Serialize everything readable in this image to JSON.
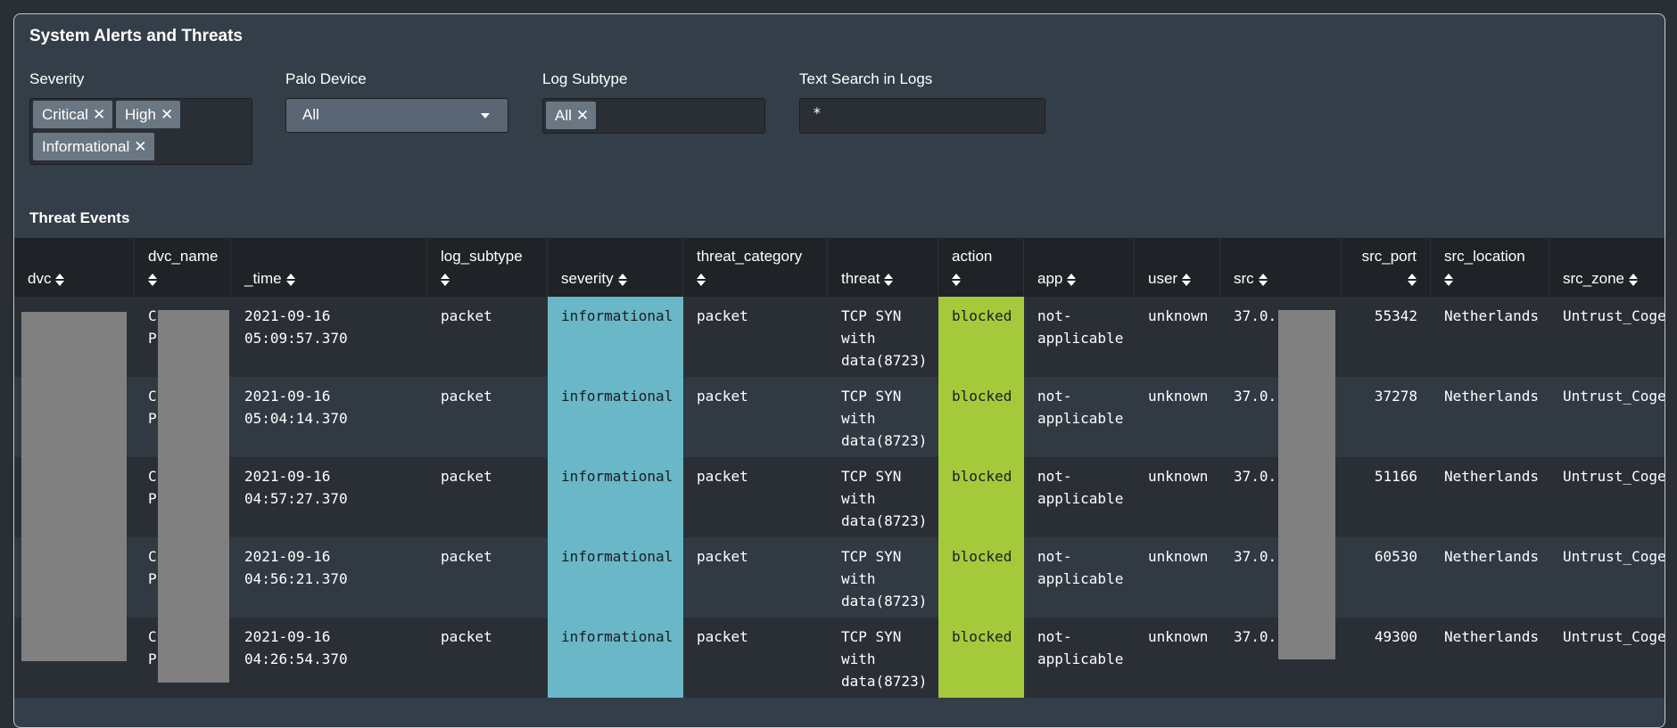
{
  "panel": {
    "title": "System Alerts and Threats"
  },
  "filters": {
    "severity": {
      "label": "Severity",
      "chips": [
        "Critical",
        "High",
        "Informational"
      ],
      "remove_glyph": "✕"
    },
    "palo_device": {
      "label": "Palo Device",
      "value": "All"
    },
    "log_subtype": {
      "label": "Log Subtype",
      "chips": [
        "All"
      ],
      "remove_glyph": "✕"
    },
    "text_search": {
      "label": "Text Search in Logs",
      "value": "*"
    }
  },
  "table": {
    "title": "Threat Events",
    "columns": [
      "dvc",
      "dvc_name",
      "_time",
      "log_subtype",
      "severity",
      "threat_category",
      "threat",
      "action",
      "app",
      "user",
      "src",
      "src_port",
      "src_location",
      "src_zone"
    ],
    "rows": [
      {
        "dvc": "",
        "dvc_name": "C\nP",
        "time": "2021-09-16\n05:09:57.370",
        "log_subtype": "packet",
        "severity": "informational",
        "threat_category": "packet",
        "threat": "TCP SYN\nwith\ndata(8723)",
        "action": "blocked",
        "app": "not-\napplicable",
        "user": "unknown",
        "src": "37.0.",
        "src_port": "55342",
        "src_location": "Netherlands",
        "src_zone": "Untrust_Coge"
      },
      {
        "dvc": "",
        "dvc_name": "C\nP",
        "time": "2021-09-16\n05:04:14.370",
        "log_subtype": "packet",
        "severity": "informational",
        "threat_category": "packet",
        "threat": "TCP SYN\nwith\ndata(8723)",
        "action": "blocked",
        "app": "not-\napplicable",
        "user": "unknown",
        "src": "37.0.",
        "src_port": "37278",
        "src_location": "Netherlands",
        "src_zone": "Untrust_Coge"
      },
      {
        "dvc": "",
        "dvc_name": "C\nP",
        "time": "2021-09-16\n04:57:27.370",
        "log_subtype": "packet",
        "severity": "informational",
        "threat_category": "packet",
        "threat": "TCP SYN\nwith\ndata(8723)",
        "action": "blocked",
        "app": "not-\napplicable",
        "user": "unknown",
        "src": "37.0.",
        "src_port": "51166",
        "src_location": "Netherlands",
        "src_zone": "Untrust_Coge"
      },
      {
        "dvc": "",
        "dvc_name": "C\nP",
        "time": "2021-09-16\n04:56:21.370",
        "log_subtype": "packet",
        "severity": "informational",
        "threat_category": "packet",
        "threat": "TCP SYN\nwith\ndata(8723)",
        "action": "blocked",
        "app": "not-\napplicable",
        "user": "unknown",
        "src": "37.0.",
        "src_port": "60530",
        "src_location": "Netherlands",
        "src_zone": "Untrust_Coge"
      },
      {
        "dvc": "",
        "dvc_name": "C\nP",
        "time": "2021-09-16\n04:26:54.370",
        "log_subtype": "packet",
        "severity": "informational",
        "threat_category": "packet",
        "threat": "TCP SYN\nwith\ndata(8723)",
        "action": "blocked",
        "app": "not-\napplicable",
        "user": "unknown",
        "src": "37.0.",
        "src_port": "49300",
        "src_location": "Netherlands",
        "src_zone": "Untrust_Coge"
      }
    ]
  },
  "colors": {
    "severity_informational": "#6ab7c7",
    "action_blocked": "#a4c93b"
  }
}
